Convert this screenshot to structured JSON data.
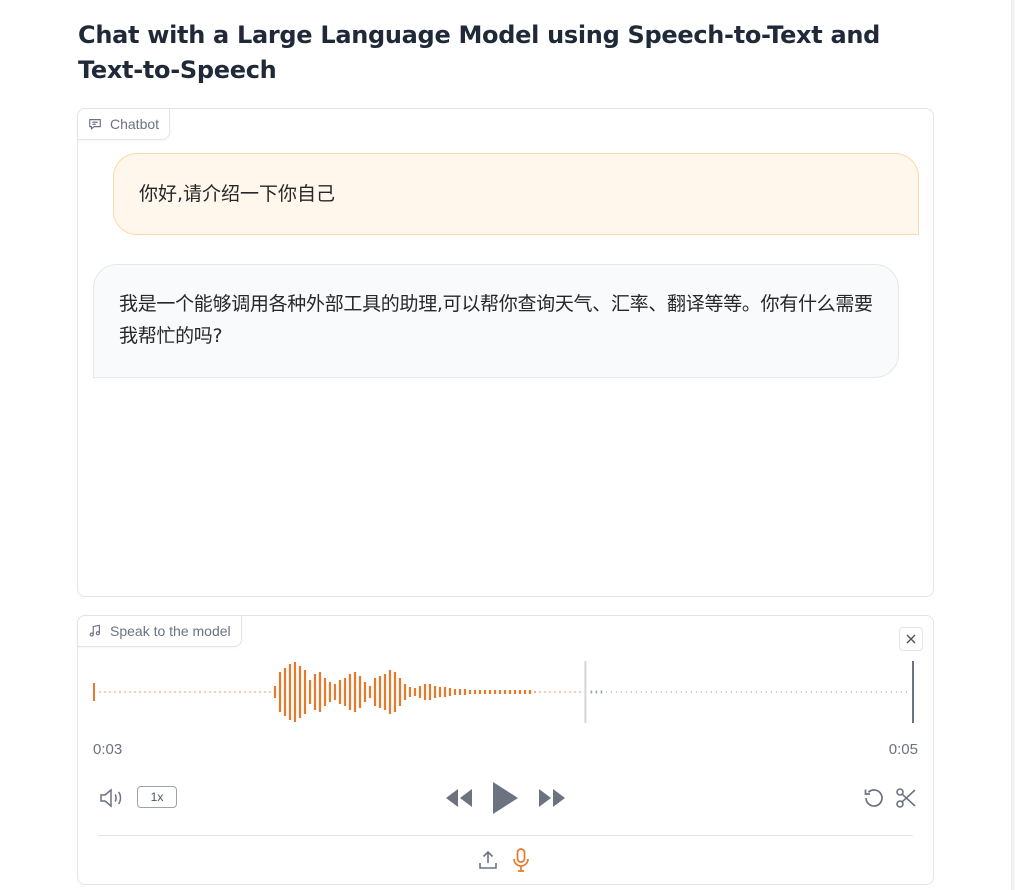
{
  "page": {
    "title": "Chat with a Large Language Model using Speech-to-Text and Text-to-Speech"
  },
  "chatbot": {
    "label": "Chatbot",
    "icon": "chat-bubble-icon",
    "messages": [
      {
        "role": "user",
        "text": "你好,请介绍一下你自己"
      },
      {
        "role": "assistant",
        "text": "我是一个能够调用各种外部工具的助理,可以帮你查询天气、汇率、翻译等等。你有什么需要我帮忙的吗?"
      }
    ]
  },
  "audio": {
    "label": "Speak to the model",
    "icon": "music-note-icon",
    "current_time": "0:03",
    "duration": "0:05",
    "speed": "1x",
    "playhead_fraction": 0.6,
    "colors": {
      "played": "#e8782a",
      "unplayed": "#9ca3af",
      "accent": "#e8782a"
    }
  }
}
